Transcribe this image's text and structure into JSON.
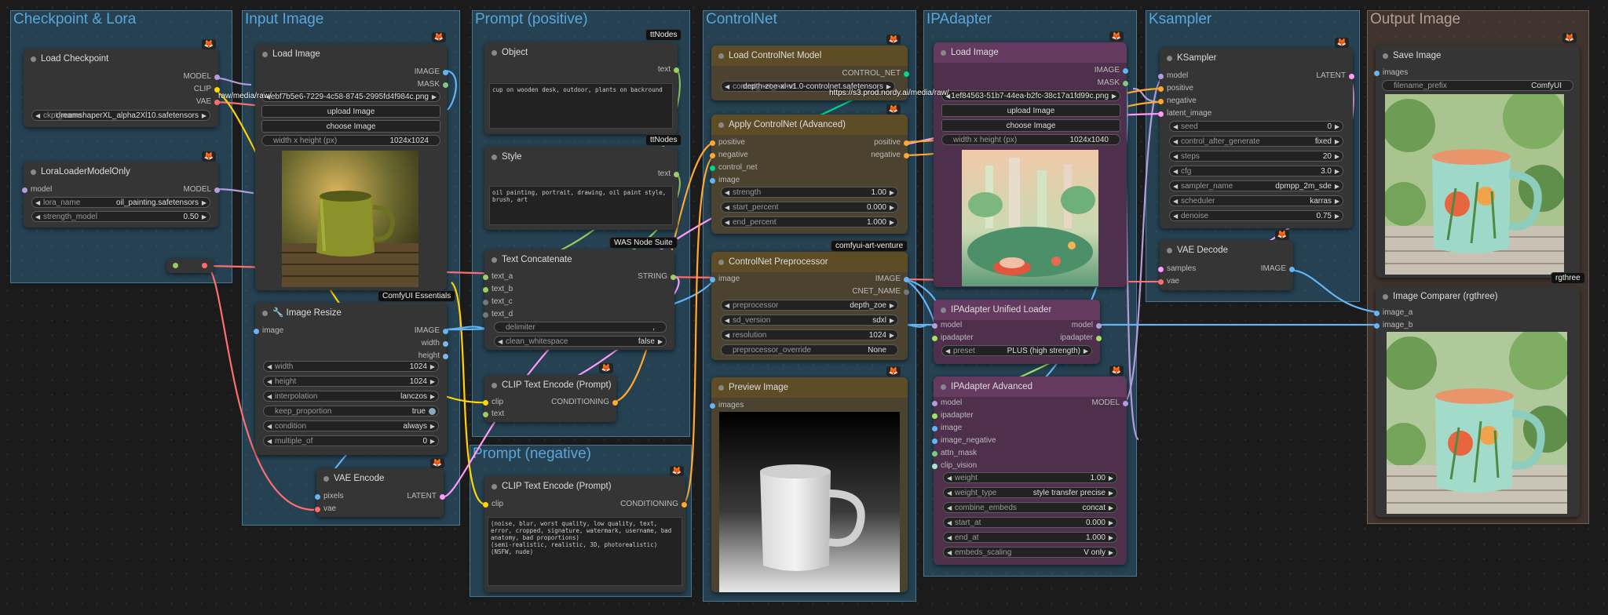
{
  "groups": {
    "checkpoint": "Checkpoint & Lora",
    "input_image": "Input Image",
    "prompt_positive": "Prompt (positive)",
    "prompt_negative": "Prompt (negative)",
    "controlnet": "ControlNet",
    "ipadapter": "IPAdapter",
    "ksampler": "Ksampler",
    "output_image": "Output Image"
  },
  "badges": {
    "ttnodes_1": "ttNodes",
    "ttnodes_2": "ttNodes",
    "was": "WAS Node Suite",
    "comfyui_essentials": "ComfyUI Essentials",
    "art_venture": "comfyui-art-venture",
    "rgthree": "rgthree",
    "fox": "🦊"
  },
  "load_checkpoint": {
    "title": "Load Checkpoint",
    "outputs": [
      "MODEL",
      "CLIP",
      "VAE"
    ],
    "ckpt_label": "ckpt_name",
    "ckpt_value": "dreamshaperXL_alpha2Xl10.safetensors"
  },
  "lora_loader": {
    "title": "LoraLoaderModelOnly",
    "input": "model",
    "output": "MODEL",
    "lora_label": "lora_name",
    "lora_value": "oil_painting.safetensors",
    "strength_label": "strength_model",
    "strength_value": "0.50"
  },
  "load_image_input": {
    "title": "Load Image",
    "outputs": [
      "IMAGE",
      "MASK"
    ],
    "image_value": "ebf7b5e6-7229-4c58-8745-2995fd4f984c.png",
    "upload": "upload Image",
    "choose": "choose Image",
    "size_label": "width x height (px)",
    "size_value": "1024x1024"
  },
  "image_resize": {
    "title": "🔧 Image Resize",
    "input": "image",
    "outputs": [
      "IMAGE",
      "width",
      "height"
    ],
    "widgets": [
      {
        "label": "width",
        "value": "1024"
      },
      {
        "label": "height",
        "value": "1024"
      },
      {
        "label": "interpolation",
        "value": "lanczos"
      },
      {
        "label": "keep_proportion",
        "value": "true"
      },
      {
        "label": "condition",
        "value": "always"
      },
      {
        "label": "multiple_of",
        "value": "0"
      }
    ]
  },
  "vae_encode": {
    "title": "VAE Encode",
    "inputs": [
      "pixels",
      "vae"
    ],
    "output": "LATENT"
  },
  "object_node": {
    "title": "Object",
    "output": "text",
    "text": "cup on wooden desk, outdoor, plants on backround"
  },
  "style_node": {
    "title": "Style",
    "output": "text",
    "text": "oil painting, portrait, drawing, oil paint style, brush, art"
  },
  "text_concat": {
    "title": "Text Concatenate",
    "inputs": [
      "text_a",
      "text_b",
      "text_c",
      "text_d"
    ],
    "output": "STRING",
    "delimiter_label": "delimiter",
    "delimiter_value": ",",
    "clean_label": "clean_whitespace",
    "clean_value": "false"
  },
  "clip_pos": {
    "title": "CLIP Text Encode (Prompt)",
    "inputs": [
      "clip",
      "text"
    ],
    "output": "CONDITIONING"
  },
  "clip_neg": {
    "title": "CLIP Text Encode (Prompt)",
    "input": "clip",
    "output": "CONDITIONING",
    "text": "(noise, blur, worst quality, low quality, text, error, cropped, signature, watermark, username, bad anatomy, bad proportions)\n(semi-realistic, realistic, 3D, photorealistic)\n(NSFW, nude)"
  },
  "load_controlnet": {
    "title": "Load ControlNet Model",
    "output": "CONTROL_NET",
    "label": "control_net_name",
    "value": "depth-zoe-xl-v1.0-controlnet.safetensors"
  },
  "apply_controlnet": {
    "title": "Apply ControlNet (Advanced)",
    "inputs": [
      "positive",
      "negative",
      "control_net",
      "image"
    ],
    "outputs": [
      "positive",
      "negative"
    ],
    "widgets": [
      {
        "label": "strength",
        "value": "1.00"
      },
      {
        "label": "start_percent",
        "value": "0.000"
      },
      {
        "label": "end_percent",
        "value": "1.000"
      }
    ]
  },
  "cn_preprocessor": {
    "title": "ControlNet Preprocessor",
    "input": "image",
    "outputs": [
      "IMAGE",
      "CNET_NAME"
    ],
    "widgets": [
      {
        "label": "preprocessor",
        "value": "depth_zoe"
      },
      {
        "label": "sd_version",
        "value": "sdxl"
      },
      {
        "label": "resolution",
        "value": "1024"
      },
      {
        "label": "preprocessor_override",
        "value": "None"
      }
    ]
  },
  "preview_image": {
    "title": "Preview Image",
    "input": "images"
  },
  "load_image_ip": {
    "title": "Load Image",
    "outputs": [
      "IMAGE",
      "MASK"
    ],
    "image_value": "1ef84563-51b7-44ea-b2fc-38c17a1fd99c.png",
    "upload": "upload Image",
    "choose": "choose Image",
    "size_label": "width x height (px)",
    "size_value": "1024x1040",
    "url_overlay": "https://s3.prod.nordy.ai/media/raw/"
  },
  "input_url_overlay": "raw/media/raw/",
  "ip_loader": {
    "title": "IPAdapter Unified Loader",
    "inputs": [
      "model",
      "ipadapter"
    ],
    "outputs": [
      "model",
      "ipadapter"
    ],
    "preset_label": "preset",
    "preset_value": "PLUS (high strength)"
  },
  "ip_advanced": {
    "title": "IPAdapter Advanced",
    "inputs": [
      "model",
      "ipadapter",
      "image",
      "image_negative",
      "attn_mask",
      "clip_vision"
    ],
    "output": "MODEL",
    "widgets": [
      {
        "label": "weight",
        "value": "1.00"
      },
      {
        "label": "weight_type",
        "value": "style transfer precise"
      },
      {
        "label": "combine_embeds",
        "value": "concat"
      },
      {
        "label": "start_at",
        "value": "0.000"
      },
      {
        "label": "end_at",
        "value": "1.000"
      },
      {
        "label": "embeds_scaling",
        "value": "V only"
      }
    ]
  },
  "ksampler": {
    "title": "KSampler",
    "inputs": [
      "model",
      "positive",
      "negative",
      "latent_image"
    ],
    "output": "LATENT",
    "widgets": [
      {
        "label": "seed",
        "value": "0"
      },
      {
        "label": "control_after_generate",
        "value": "fixed"
      },
      {
        "label": "steps",
        "value": "20"
      },
      {
        "label": "cfg",
        "value": "3.0"
      },
      {
        "label": "sampler_name",
        "value": "dpmpp_2m_sde"
      },
      {
        "label": "scheduler",
        "value": "karras"
      },
      {
        "label": "denoise",
        "value": "0.75"
      }
    ]
  },
  "vae_decode": {
    "title": "VAE Decode",
    "inputs": [
      "samples",
      "vae"
    ],
    "output": "IMAGE"
  },
  "save_image": {
    "title": "Save Image",
    "input": "images",
    "prefix_label": "filename_prefix",
    "prefix_value": "ComfyUI"
  },
  "image_comparer": {
    "title": "Image Comparer (rgthree)",
    "inputs": [
      "image_a",
      "image_b"
    ]
  },
  "colors": {
    "model": "#b39ddb",
    "clip": "#ffd500",
    "vae": "#ff6e6e",
    "image": "#64b5f6",
    "mask": "#81c784",
    "latent": "#ff9cf9",
    "conditioning": "#ffa931",
    "string": "#9ccc65",
    "controlnet": "#00d78d",
    "ipadapter": "#9fe46a"
  }
}
